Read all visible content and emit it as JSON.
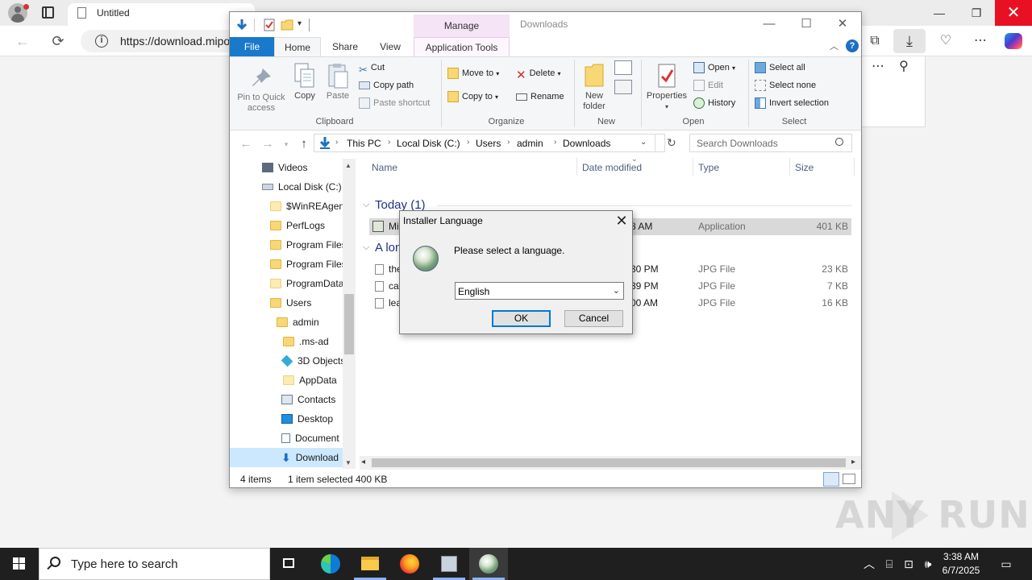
{
  "browser": {
    "tab_title": "Untitled",
    "url": "https://download.mipo",
    "controls": {
      "minimize": "—",
      "maximize": "❐",
      "close": "✕"
    },
    "nav": {
      "back": "←",
      "refresh": "⟳"
    },
    "toolbar_icons": {
      "collections": "⧉",
      "downloads": "⤓",
      "extensions": "♡",
      "more": "⋯"
    },
    "panel_icons": {
      "more": "⋯",
      "pin": "⚲"
    }
  },
  "explorer": {
    "window_title": "Downloads",
    "contextual_tab": "Manage",
    "controls": {
      "minimize": "—",
      "maximize": "☐",
      "close": "✕"
    },
    "tabs": {
      "file": "File",
      "home": "Home",
      "share": "Share",
      "view": "View",
      "app_tools": "Application Tools"
    },
    "ribbon": {
      "clipboard": {
        "label": "Clipboard",
        "pin_line1": "Pin to Quick",
        "pin_line2": "access",
        "copy": "Copy",
        "paste": "Paste",
        "cut": "Cut",
        "copy_path": "Copy path",
        "paste_shortcut": "Paste shortcut"
      },
      "organize": {
        "label": "Organize",
        "move_to": "Move to",
        "copy_to": "Copy to",
        "delete": "Delete",
        "rename": "Rename"
      },
      "new": {
        "label": "New",
        "new_folder_line1": "New",
        "new_folder_line2": "folder"
      },
      "open": {
        "label": "Open",
        "properties": "Properties",
        "open": "Open",
        "edit": "Edit",
        "history": "History"
      },
      "select": {
        "label": "Select",
        "select_all": "Select all",
        "select_none": "Select none",
        "invert": "Invert selection"
      }
    },
    "address": {
      "crumbs": [
        "This PC",
        "Local Disk (C:)",
        "Users",
        "admin",
        "Downloads"
      ],
      "search_placeholder": "Search Downloads"
    },
    "tree": [
      "Videos",
      "Local Disk (C:)",
      "$WinREAgent",
      "PerfLogs",
      "Program Files",
      "Program Files",
      "ProgramData",
      "Users",
      "admin",
      ".ms-ad",
      "3D Objects",
      "AppData",
      "Contacts",
      "Desktop",
      "Document",
      "Download"
    ],
    "columns": {
      "name": "Name",
      "date": "Date modified",
      "type": "Type",
      "size": "Size"
    },
    "groups": {
      "today": "Today (1)",
      "older": "A lon"
    },
    "files_today": [
      {
        "name": "Mi",
        "date": "8 AM",
        "type": "Application",
        "size": "401 KB"
      }
    ],
    "files_older": [
      {
        "name": "the",
        "date": "30 PM",
        "type": "JPG File",
        "size": "23 KB"
      },
      {
        "name": "cat",
        "date": "39 PM",
        "type": "JPG File",
        "size": "7 KB"
      },
      {
        "name": "lea",
        "date": "00 AM",
        "type": "JPG File",
        "size": "16 KB"
      }
    ],
    "status": {
      "items": "4 items",
      "selected": "1 item selected",
      "size": "400 KB"
    }
  },
  "dialog": {
    "title": "Installer Language",
    "close": "✕",
    "message": "Please select a language.",
    "selected_language": "English",
    "ok": "OK",
    "cancel": "Cancel"
  },
  "watermark": {
    "text": "ANY RUN"
  },
  "taskbar": {
    "search_placeholder": "Type here to search",
    "time": "3:38 AM",
    "date": "6/7/2025"
  }
}
